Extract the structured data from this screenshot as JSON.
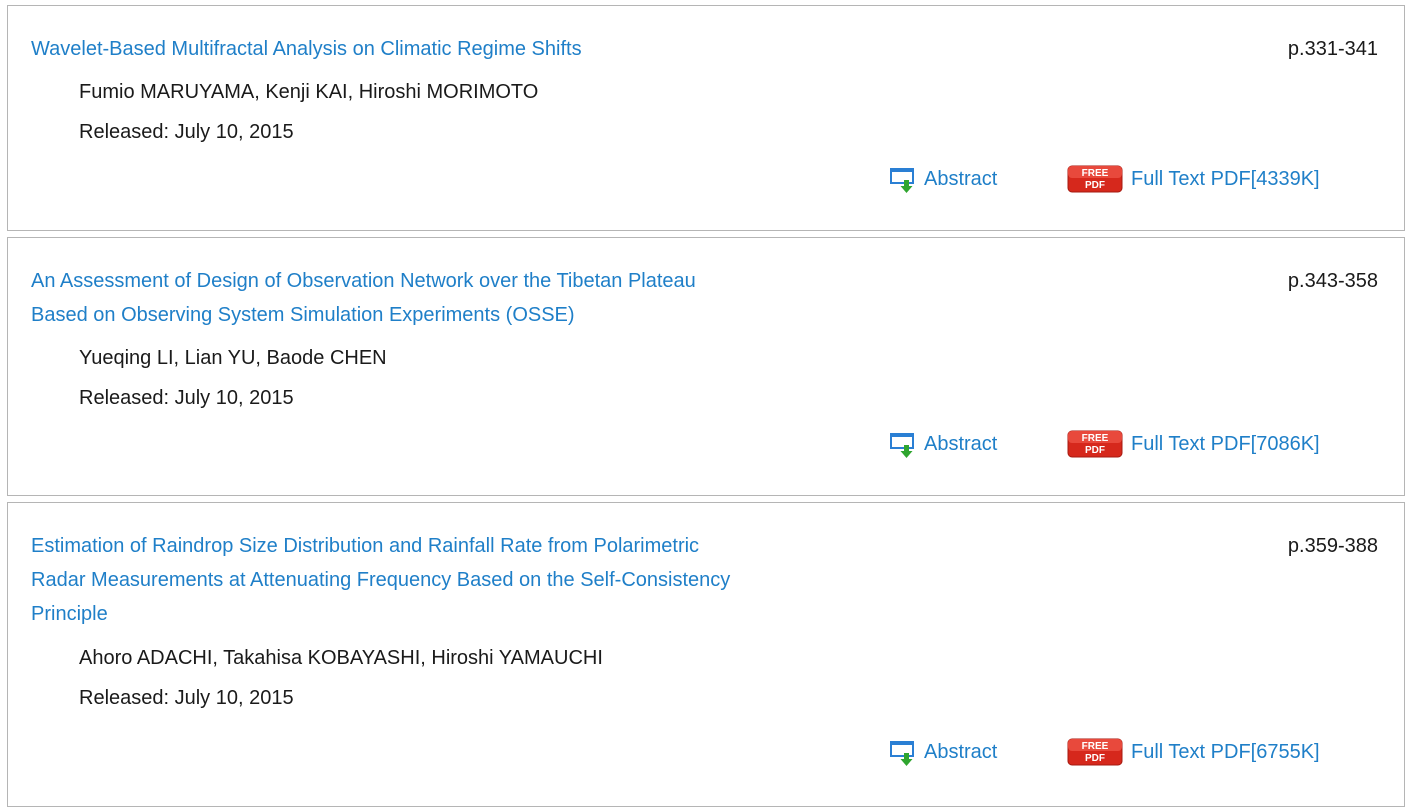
{
  "articles": [
    {
      "title_lines": [
        "Wavelet-Based Multifractal Analysis on Climatic Regime Shifts"
      ],
      "pages": "p.331-341",
      "authors": "Fumio MARUYAMA, Kenji KAI, Hiroshi MORIMOTO",
      "released": "Released: July 10, 2015",
      "abstract_label": "Abstract",
      "pdf_label": "Full Text PDF[4339K]"
    },
    {
      "title_lines": [
        "An Assessment of Design of Observation Network over the Tibetan Plateau",
        "Based on Observing System Simulation Experiments (OSSE)"
      ],
      "pages": "p.343-358",
      "authors": "Yueqing LI, Lian YU, Baode CHEN",
      "released": "Released: July 10, 2015",
      "abstract_label": "Abstract",
      "pdf_label": "Full Text PDF[7086K]"
    },
    {
      "title_lines": [
        "Estimation of Raindrop Size Distribution and Rainfall Rate from Polarimetric",
        "Radar Measurements at Attenuating Frequency Based on the Self-Consistency",
        "Principle"
      ],
      "pages": "p.359-388",
      "authors": "Ahoro ADACHI, Takahisa KOBAYASHI, Hiroshi YAMAUCHI",
      "released": "Released: July 10, 2015",
      "abstract_label": "Abstract",
      "pdf_label": "Full Text PDF[6755K]"
    }
  ],
  "badge": {
    "top": "FREE",
    "bottom": "PDF"
  },
  "icons": {
    "abstract": "abstract-download-icon",
    "pdf": "free-pdf-badge-icon"
  },
  "colors": {
    "link": "#1f7fc8",
    "border": "#b5b5b5",
    "badge_red": "#d6281c",
    "icon_blue": "#2a7fd4",
    "icon_green": "#2fa52f"
  }
}
